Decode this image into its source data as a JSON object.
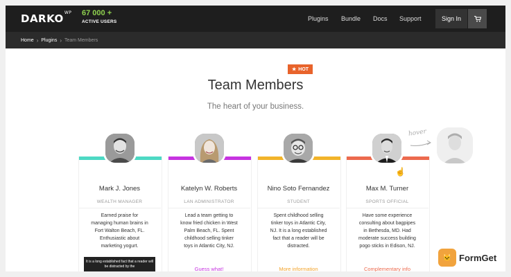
{
  "header": {
    "logo": "DARKO",
    "logo_sup": "WP",
    "users_count": "67 000 +",
    "users_label": "ACTIVE USERS",
    "nav": [
      {
        "label": "Plugins"
      },
      {
        "label": "Bundle"
      },
      {
        "label": "Docs"
      },
      {
        "label": "Support"
      }
    ],
    "signin": "Sign In",
    "cart_icon": "cart-icon"
  },
  "breadcrumb": {
    "items": [
      "Home",
      "Plugins",
      "Team Members"
    ]
  },
  "badge": {
    "label": "HOT",
    "icon": "star-icon",
    "color": "#e8632b"
  },
  "section": {
    "title": "Team Members",
    "subtitle": "The heart of your business."
  },
  "hover_hint": "hover",
  "members": [
    {
      "name": "Mark J. Jones",
      "role": "WEALTH MANAGER",
      "color": "#4dd9c4",
      "desc": [
        "Earned praise for",
        "managing human brains in",
        "Fort Walton Beach, FL.",
        "Enthusiastic about",
        "marketing yogurt."
      ],
      "tooltip": "It is a long established fact that a reader will be distracted by the",
      "link": ""
    },
    {
      "name": "Katelyn W. Roberts",
      "role": "LAN ADMINISTRATOR",
      "color": "#c633e0",
      "desc": [
        "Lead a team getting to",
        "know fried chicken in West",
        "Palm Beach, FL. Spent",
        "childhood selling tinker",
        "toys in Atlantic City, NJ."
      ],
      "link": "Guess what!"
    },
    {
      "name": "Nino Soto Fernandez",
      "role": "STUDENT",
      "color": "#f2b42a",
      "desc": [
        "Spent childhood selling",
        "tinker toys in Atlantic City,",
        "NJ. It is a long established",
        "fact that a reader will be",
        "distracted."
      ],
      "link": "More information"
    },
    {
      "name": "Max M.  Turner",
      "role": "SPORTS OFFICIAL",
      "color": "#ec6a4e",
      "desc": [
        "Have some experience",
        "consulting about bagpipes",
        "in Bethesda, MD. Had",
        "moderate success building",
        "pogo sticks in Edison, NJ."
      ],
      "link": "Complementary info"
    }
  ],
  "watermark": {
    "label": "FormGet"
  }
}
